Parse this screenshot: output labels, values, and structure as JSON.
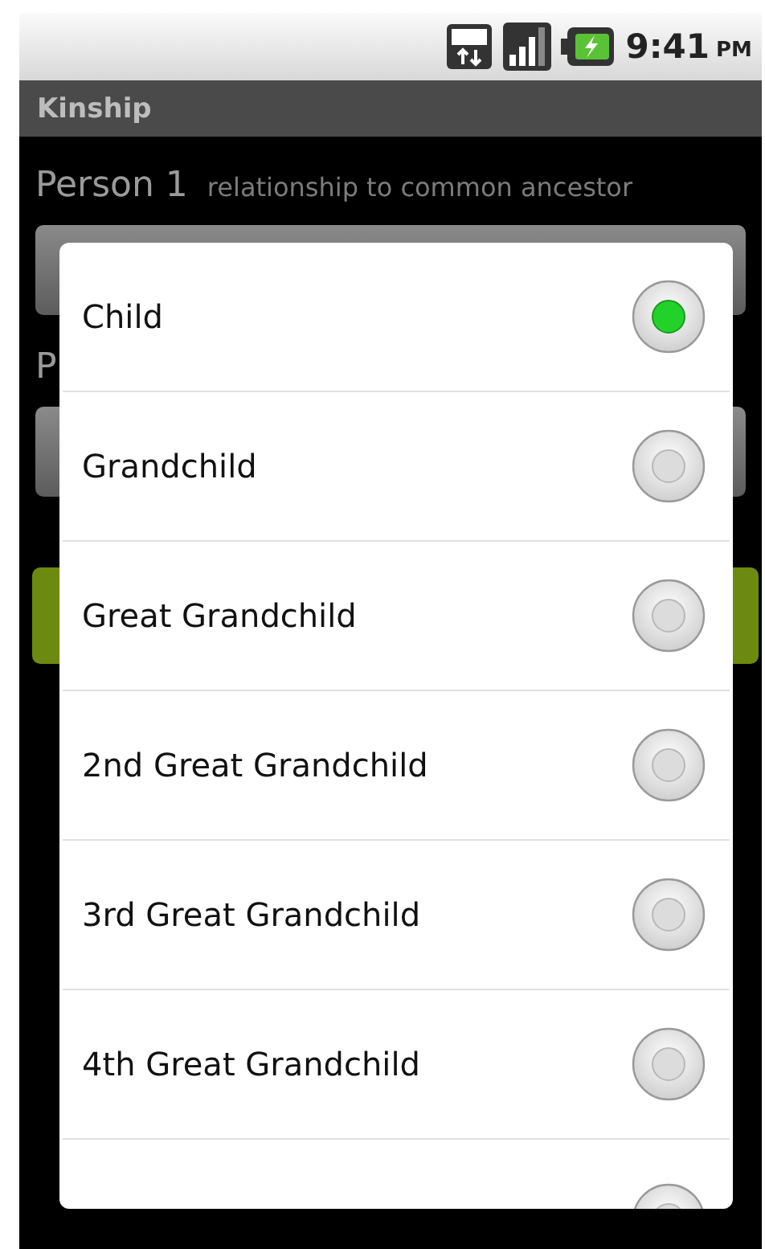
{
  "status_bar": {
    "time": "9:41",
    "meridiem": "PM"
  },
  "title_bar": {
    "title": "Kinship"
  },
  "person_1": {
    "label": "Person 1",
    "hint": "relationship to common ancestor"
  },
  "person_2": {
    "label": "P"
  },
  "dialog": {
    "options": [
      {
        "label": "Child",
        "selected": true
      },
      {
        "label": "Grandchild",
        "selected": false
      },
      {
        "label": "Great Grandchild",
        "selected": false
      },
      {
        "label": "2nd Great Grandchild",
        "selected": false
      },
      {
        "label": "3rd Great Grandchild",
        "selected": false
      },
      {
        "label": "4th Great Grandchild",
        "selected": false
      },
      {
        "selected": false
      }
    ]
  }
}
